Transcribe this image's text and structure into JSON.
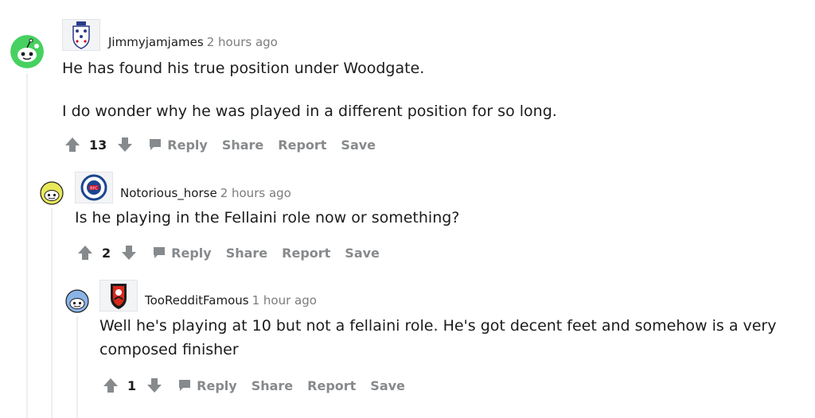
{
  "comments": [
    {
      "username": "Jimmyjamjames",
      "time": "2 hours ago",
      "body": [
        "He has found his true position under Woodgate.",
        "I do wonder why he was played in a different position for so long."
      ],
      "score": "13",
      "actions": {
        "reply": "Reply",
        "share": "Share",
        "report": "Report",
        "save": "Save"
      },
      "flair_icon": "england-crest-icon",
      "avatar_color": "#46d160"
    },
    {
      "username": "Notorious_horse",
      "time": "2 hours ago",
      "body": [
        "Is he playing in the Fellaini role now or something?"
      ],
      "score": "2",
      "actions": {
        "reply": "Reply",
        "share": "Share",
        "report": "Report",
        "save": "Save"
      },
      "flair_icon": "rangers-crest-icon",
      "avatar_color": "#e8e85a"
    },
    {
      "username": "TooRedditFamous",
      "time": "1 hour ago",
      "body": [
        "Well he's playing at 10 but not a fellaini role. He's got decent feet and somehow is a very composed finisher"
      ],
      "score": "1",
      "actions": {
        "reply": "Reply",
        "share": "Share",
        "report": "Report",
        "save": "Save"
      },
      "flair_icon": "bournemouth-crest-icon",
      "avatar_color": "#8ab4e8"
    }
  ],
  "colors": {
    "meta_gray": "#7c7c7c",
    "action_gray": "#878a8c",
    "thread_line": "#edeff1"
  }
}
